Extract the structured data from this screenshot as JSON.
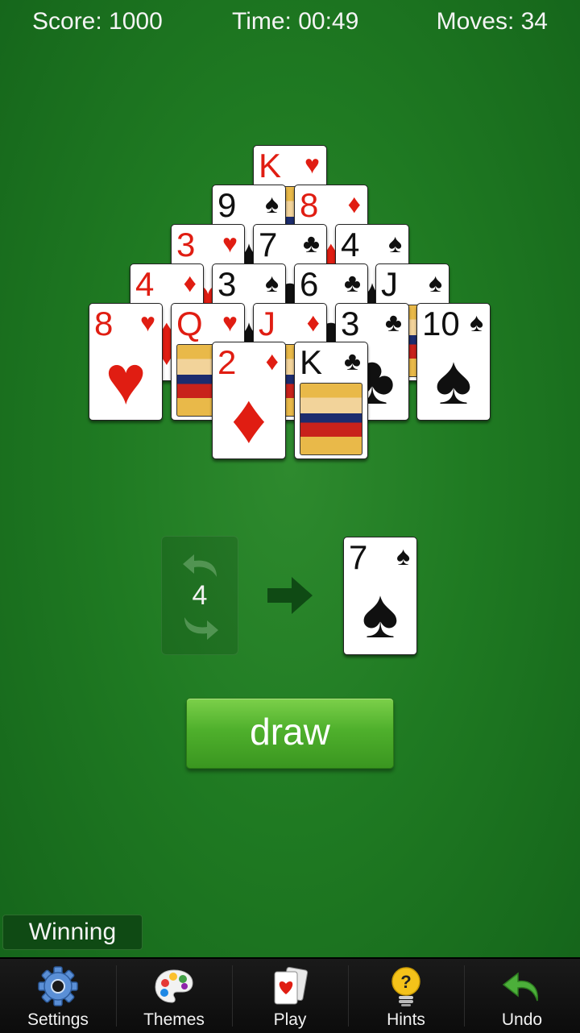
{
  "hud": {
    "score": "Score: 1000",
    "time": "Time: 00:49",
    "moves": "Moves: 34"
  },
  "pyramid": [
    {
      "rank": "K",
      "suit": "♥",
      "color": "red"
    },
    {
      "rank": "9",
      "suit": "♠",
      "color": "black"
    },
    {
      "rank": "8",
      "suit": "♦",
      "color": "red"
    },
    {
      "rank": "3",
      "suit": "♥",
      "color": "red"
    },
    {
      "rank": "7",
      "suit": "♣",
      "color": "black"
    },
    {
      "rank": "4",
      "suit": "♠",
      "color": "black"
    },
    {
      "rank": "4",
      "suit": "♦",
      "color": "red"
    },
    {
      "rank": "3",
      "suit": "♠",
      "color": "black"
    },
    {
      "rank": "6",
      "suit": "♣",
      "color": "black"
    },
    {
      "rank": "J",
      "suit": "♠",
      "color": "black"
    },
    {
      "rank": "8",
      "suit": "♥",
      "color": "red"
    },
    {
      "rank": "Q",
      "suit": "♥",
      "color": "red"
    },
    {
      "rank": "J",
      "suit": "♦",
      "color": "red"
    },
    {
      "rank": "3",
      "suit": "♣",
      "color": "black"
    },
    {
      "rank": "10",
      "suit": "♠",
      "color": "black"
    },
    {
      "rank": "2",
      "suit": "♦",
      "color": "red"
    },
    {
      "rank": "K",
      "suit": "♣",
      "color": "black"
    }
  ],
  "stock": {
    "count": "4"
  },
  "waste": {
    "rank": "7",
    "suit": "♠",
    "color": "black"
  },
  "draw_button": {
    "label": "draw"
  },
  "status": {
    "label": "Winning"
  },
  "toolbar": {
    "settings": {
      "label": "Settings",
      "icon": "gear-icon"
    },
    "themes": {
      "label": "Themes",
      "icon": "palette-icon"
    },
    "play": {
      "label": "Play",
      "icon": "cards-icon"
    },
    "hints": {
      "label": "Hints",
      "icon": "lightbulb-icon"
    },
    "undo": {
      "label": "Undo",
      "icon": "undo-arrow-icon"
    }
  },
  "colors": {
    "felt": "#1f7a22",
    "button": "#4fb02c",
    "red_suit": "#e01d12"
  }
}
